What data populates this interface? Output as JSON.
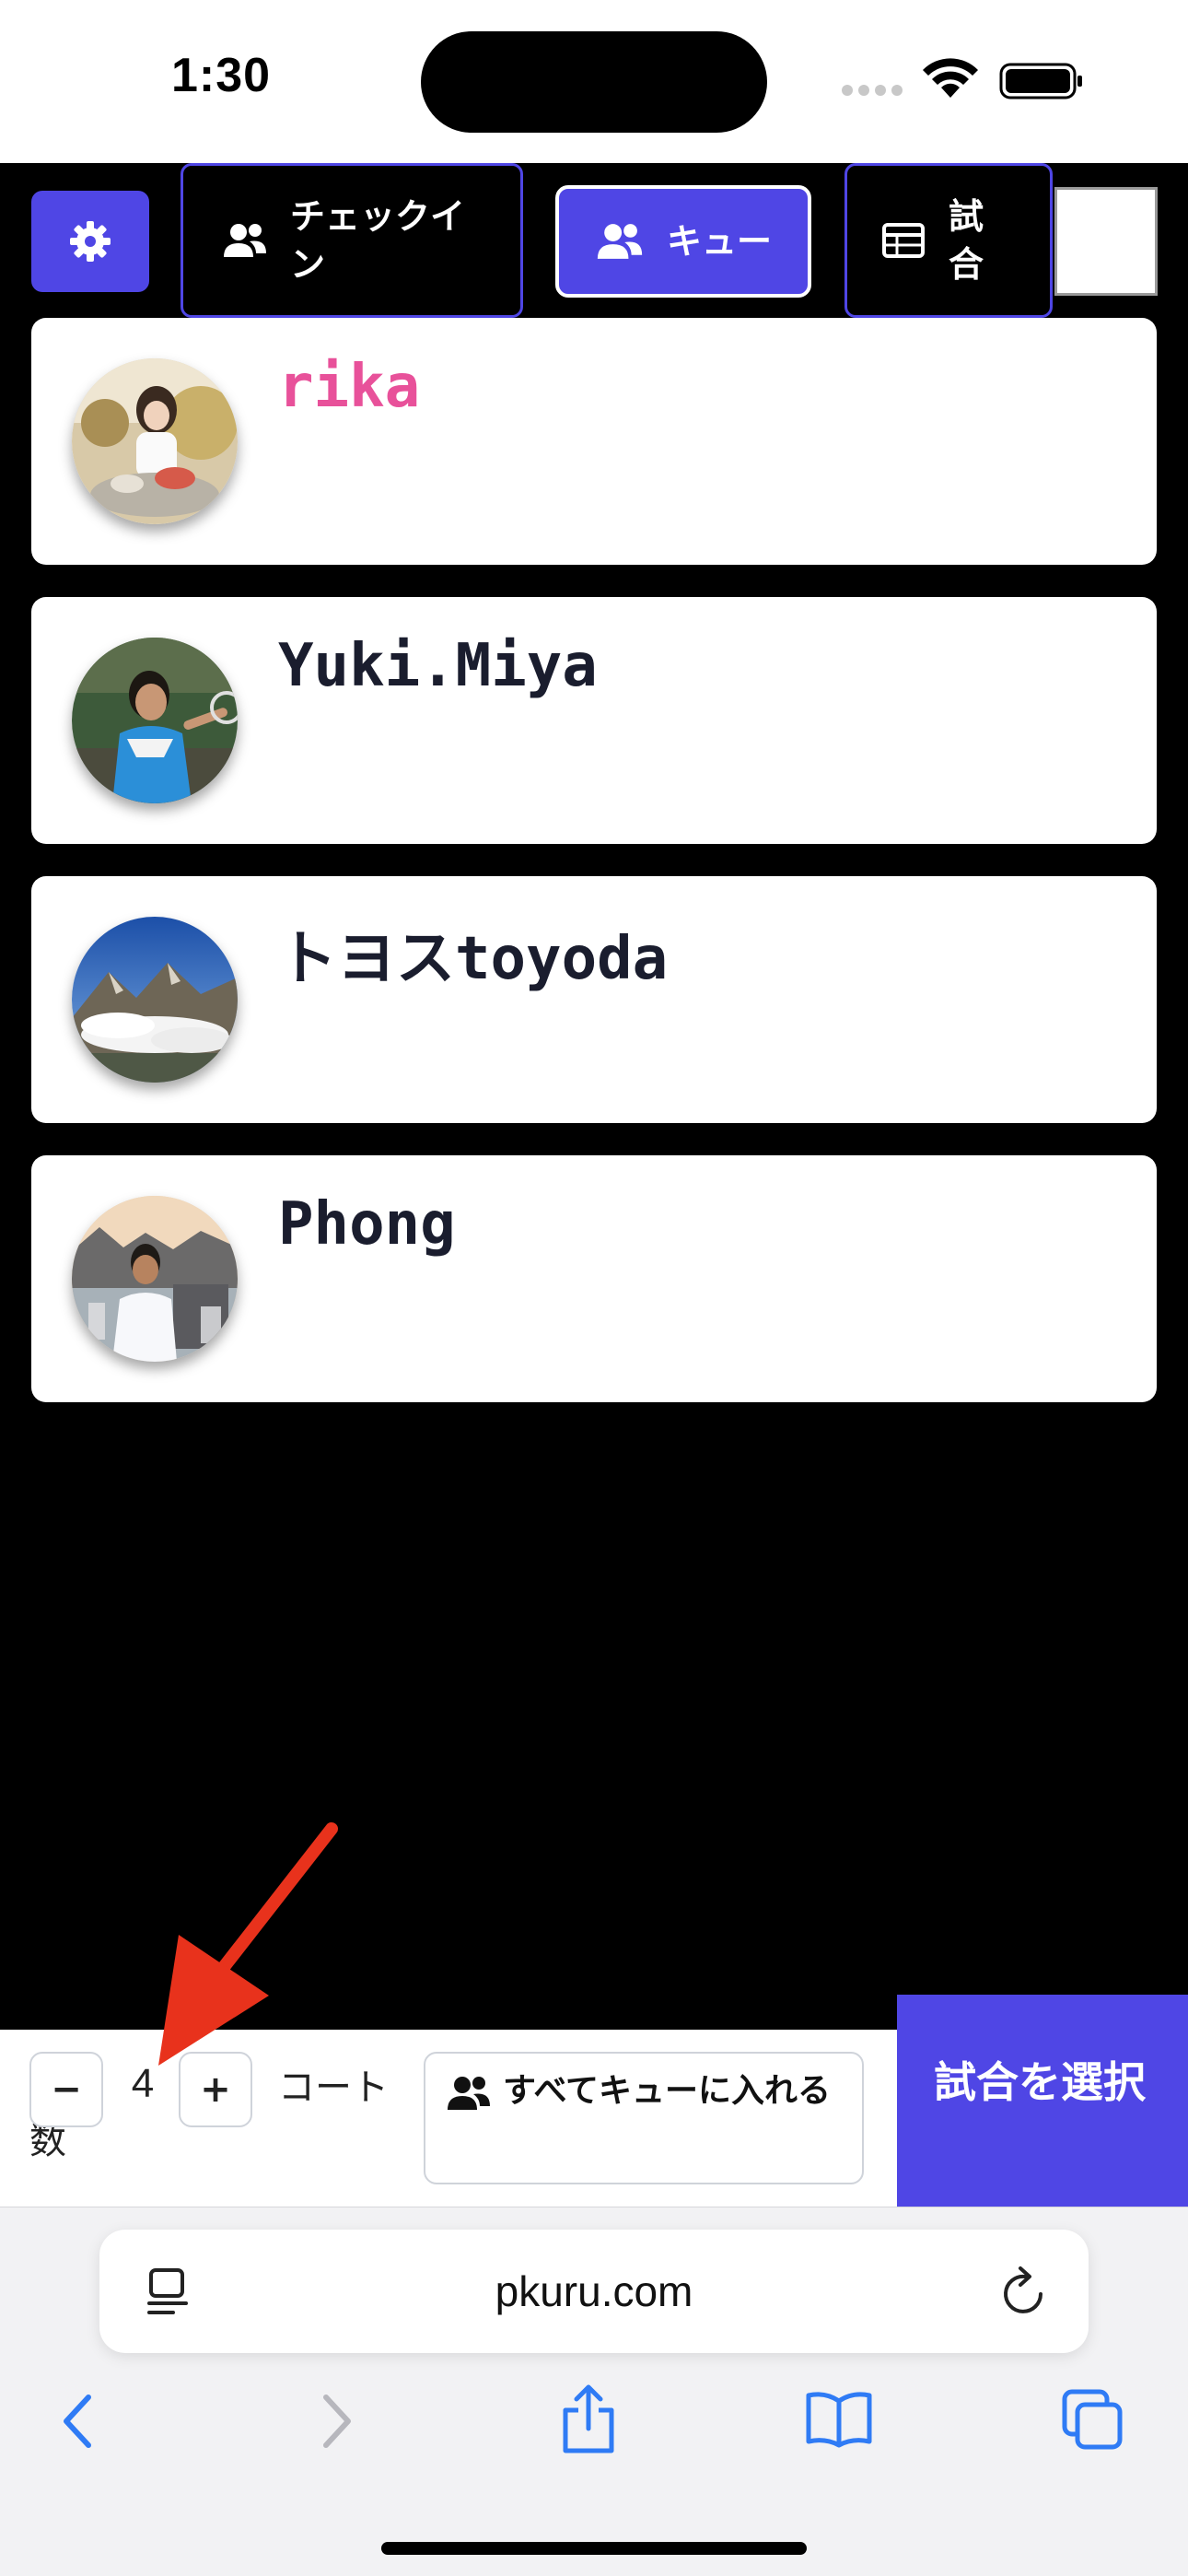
{
  "status_bar": {
    "time": "1:30"
  },
  "tabs": {
    "checkin_label": "チェックイン",
    "queue_label": "キュー",
    "match_label": "試合"
  },
  "players": [
    {
      "name": "rika",
      "name_color": "#e8519a"
    },
    {
      "name": "Yuki.Miya",
      "name_color": "#1a1d2e"
    },
    {
      "name": "トヨスtoyoda",
      "name_color": "#1a1d2e"
    },
    {
      "name": "Phong",
      "name_color": "#1a1d2e"
    }
  ],
  "controls": {
    "minus_label": "−",
    "court_count": "4",
    "plus_label": "+",
    "court_label": "コート数",
    "queue_all_label": "すべてキューに入れる",
    "select_match_label": "試合を選択"
  },
  "browser": {
    "url": "pkuru.com"
  },
  "colors": {
    "accent": "#4f46e5",
    "background": "#000000",
    "highlight_name": "#e8519a",
    "annotation_arrow": "#e8321c"
  },
  "icons": [
    "gear-icon",
    "users-icon",
    "table-icon",
    "reader-icon",
    "reload-icon",
    "back-icon",
    "forward-icon",
    "share-icon",
    "bookmarks-icon",
    "tabs-icon"
  ]
}
